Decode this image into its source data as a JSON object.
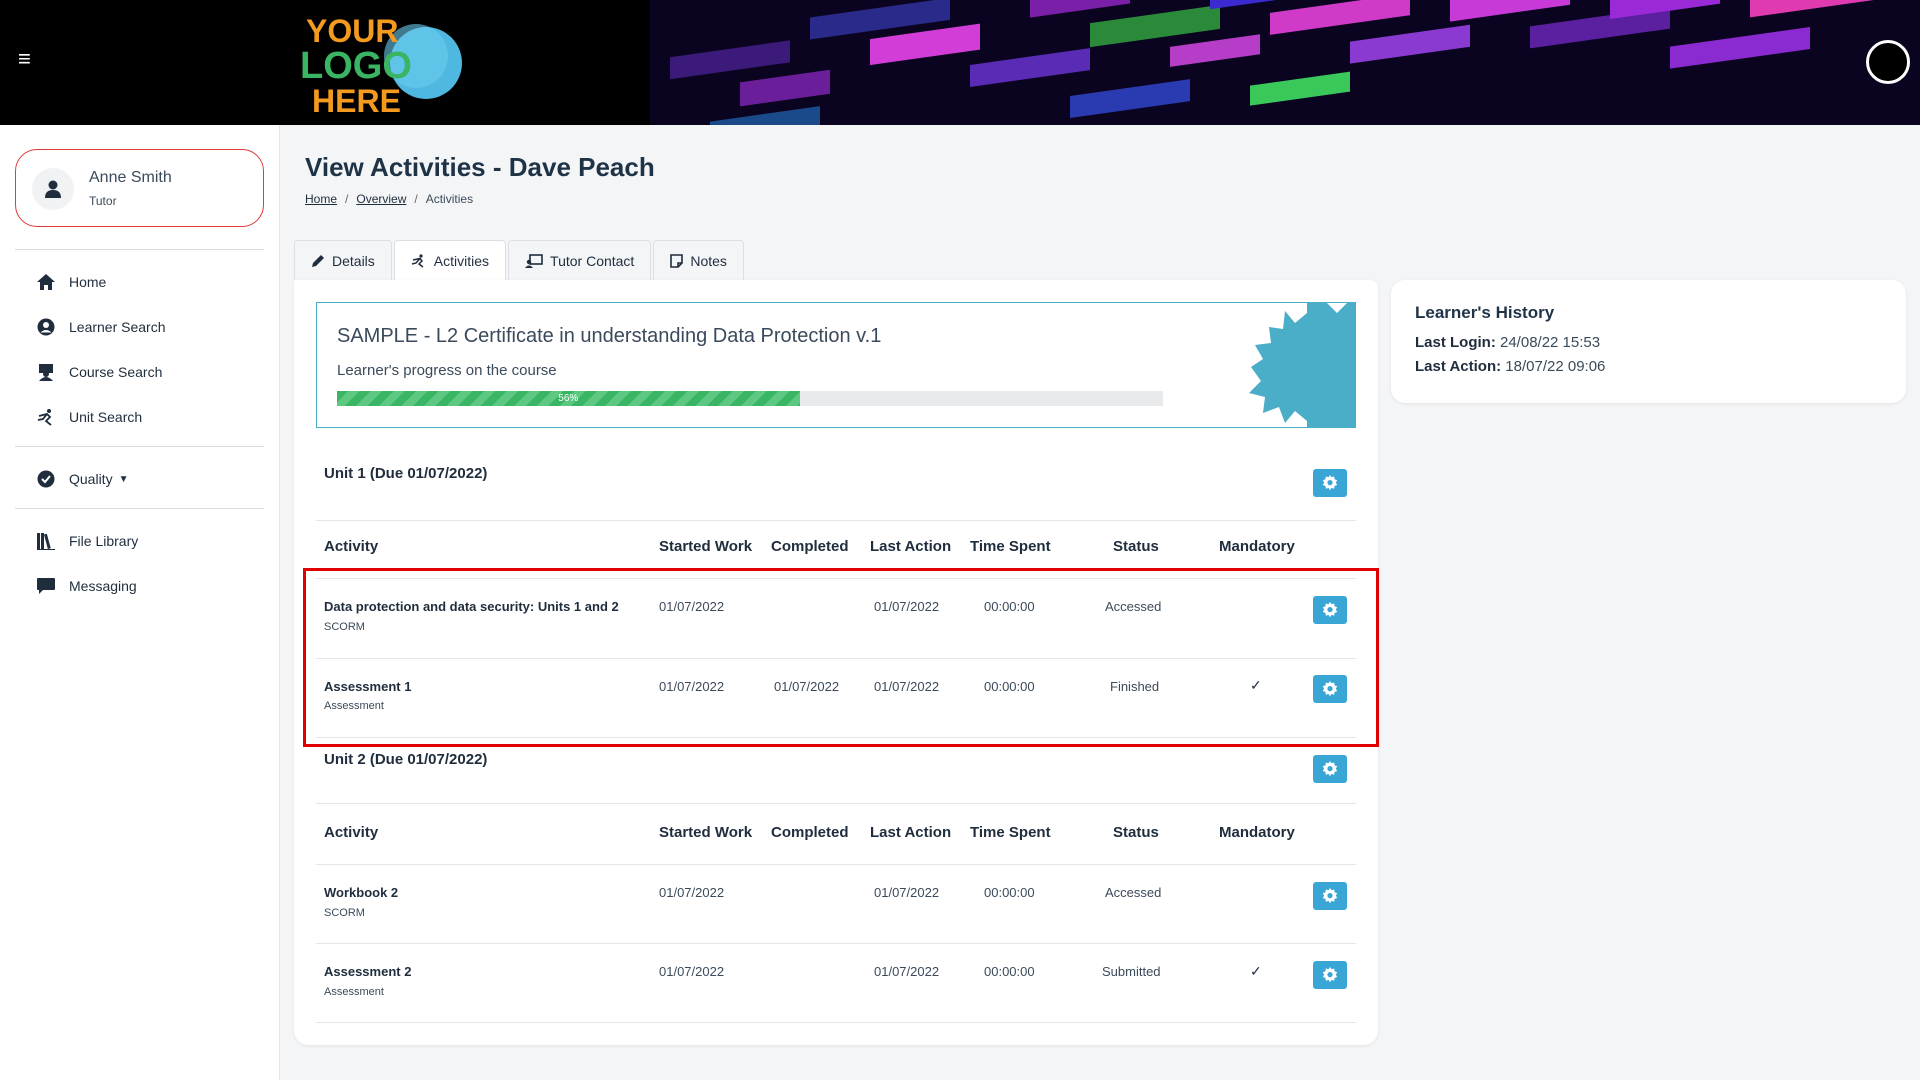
{
  "header": {
    "logo_line1": "YOUR",
    "logo_line2": "LOGO",
    "logo_line3": "HERE"
  },
  "user": {
    "name": "Anne Smith",
    "role": "Tutor"
  },
  "sidebar": {
    "items": [
      {
        "label": "Home",
        "icon": "home-icon"
      },
      {
        "label": "Learner Search",
        "icon": "user-circle-icon"
      },
      {
        "label": "Course Search",
        "icon": "course-icon"
      },
      {
        "label": "Unit Search",
        "icon": "unit-icon"
      },
      {
        "label": "Quality",
        "icon": "check-circle-icon"
      },
      {
        "label": "File Library",
        "icon": "books-icon"
      },
      {
        "label": "Messaging",
        "icon": "chat-icon"
      }
    ]
  },
  "page": {
    "title": "View Activities - Dave Peach",
    "breadcrumb": [
      "Home",
      "Overview",
      "Activities"
    ]
  },
  "tabs": [
    {
      "label": "Details",
      "icon": "pencil-icon"
    },
    {
      "label": "Activities",
      "icon": "activity-icon"
    },
    {
      "label": "Tutor Contact",
      "icon": "tutor-icon"
    },
    {
      "label": "Notes",
      "icon": "note-icon"
    }
  ],
  "course": {
    "title": "SAMPLE - L2 Certificate in understanding Data Protection v.1",
    "subtitle": "Learner's progress on the course",
    "progress_label": "56%",
    "progress": 0.56
  },
  "columns": [
    "Activity",
    "Started Work",
    "Completed",
    "Last Action",
    "Time Spent",
    "Status",
    "Mandatory"
  ],
  "units": [
    {
      "heading": "Unit 1 (Due 01/07/2022)",
      "rows": [
        {
          "name": "Data protection and data security: Units 1 and 2",
          "type": "SCORM",
          "started": "01/07/2022",
          "completed": "",
          "last_action": "01/07/2022",
          "time_spent": "00:00:00",
          "status": "Accessed",
          "mandatory": ""
        },
        {
          "name": "Assessment 1",
          "type": "Assessment",
          "started": "01/07/2022",
          "completed": "01/07/2022",
          "last_action": "01/07/2022",
          "time_spent": "00:00:00",
          "status": "Finished",
          "mandatory": "✓"
        }
      ]
    },
    {
      "heading": "Unit 2 (Due 01/07/2022)",
      "rows": [
        {
          "name": "Workbook 2",
          "type": "SCORM",
          "started": "01/07/2022",
          "completed": "",
          "last_action": "01/07/2022",
          "time_spent": "00:00:00",
          "status": "Accessed",
          "mandatory": ""
        },
        {
          "name": "Assessment 2",
          "type": "Assessment",
          "started": "01/07/2022",
          "completed": "",
          "last_action": "01/07/2022",
          "time_spent": "00:00:00",
          "status": "Submitted",
          "mandatory": "✓"
        }
      ]
    }
  ],
  "history": {
    "title": "Learner's History",
    "last_login_label": "Last Login:",
    "last_login": "24/08/22 15:53",
    "last_action_label": "Last Action:",
    "last_action": "18/07/22 09:06"
  },
  "colors": {
    "accent": "#3aa6d6",
    "highlight": "#e00000",
    "progress": "#3ab563"
  }
}
